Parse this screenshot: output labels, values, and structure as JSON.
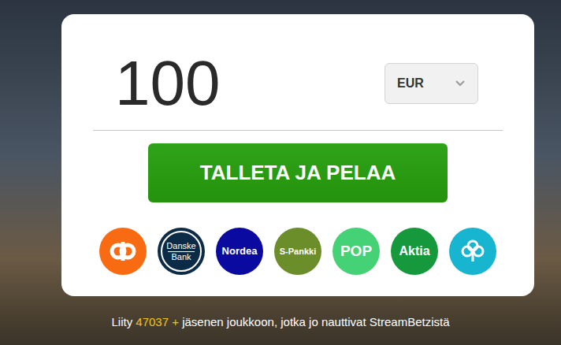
{
  "deposit": {
    "amount": "100",
    "currency": "EUR",
    "button": "TALLETA JA PELAA"
  },
  "banks": [
    {
      "name": "OP",
      "kind": "op-icon",
      "lines": [],
      "color": "#f96b13"
    },
    {
      "name": "Danske Bank",
      "kind": "text",
      "lines": [
        "Danske",
        "Bank"
      ],
      "color": "#0c2b47"
    },
    {
      "name": "Nordea",
      "kind": "text",
      "lines": [
        "Nordea"
      ],
      "color": "#0a0aa0"
    },
    {
      "name": "S-Pankki",
      "kind": "text",
      "lines": [
        "S-Pankki"
      ],
      "color": "#6b8e2b"
    },
    {
      "name": "POP",
      "kind": "text",
      "lines": [
        "POP"
      ],
      "color": "#45d175"
    },
    {
      "name": "Aktia",
      "kind": "text",
      "lines": [
        "Aktia"
      ],
      "color": "#16993c"
    },
    {
      "name": "Säästöpankki",
      "kind": "clover-icon",
      "lines": [],
      "color": "#17b5d0"
    }
  ],
  "footer": {
    "prefix": "Liity",
    "count": "47037 +",
    "suffix": "jäsenen joukkoon, jotka jo nauttivat StreamBetzistä"
  }
}
